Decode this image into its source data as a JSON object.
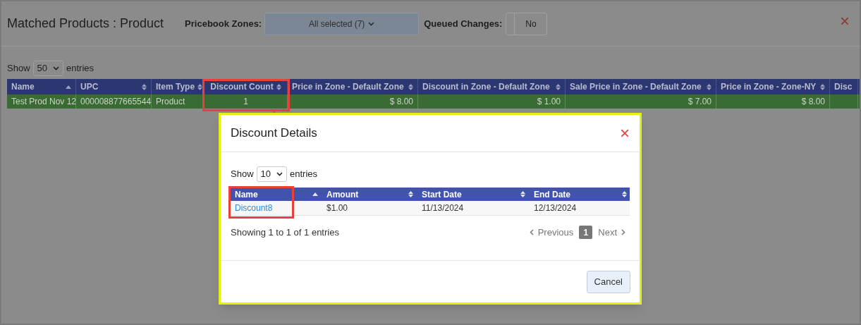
{
  "page": {
    "title": "Matched Products : Product",
    "zones_label": "Pricebook Zones:",
    "zones_value": "All selected (7)",
    "queued_label": "Queued Changes:",
    "queued_value": "No",
    "close": "×"
  },
  "length": {
    "show": "Show",
    "value": "50",
    "entries": "entries"
  },
  "table": {
    "columns": [
      {
        "label": "Name",
        "kind": "sorted"
      },
      {
        "label": "UPC",
        "kind": "text"
      },
      {
        "label": "Item Type",
        "kind": "text"
      },
      {
        "label": "Discount Count",
        "kind": "count"
      },
      {
        "label": "Price in Zone - Default Zone",
        "kind": "money"
      },
      {
        "label": "Discount in Zone - Default Zone",
        "kind": "money"
      },
      {
        "label": "Sale Price in Zone - Default Zone",
        "kind": "money"
      },
      {
        "label": "Price in Zone - Zone-NY",
        "kind": "money"
      },
      {
        "label": "Disc",
        "kind": "cut"
      }
    ],
    "rows": [
      {
        "selected": true,
        "cells": [
          "Test Prod Nov 12",
          "000008877665544",
          "Product",
          "1",
          "$ 8.00",
          "$ 1.00",
          "$ 7.00",
          "$ 8.00",
          ""
        ]
      }
    ]
  },
  "dialog": {
    "title": "Discount Details",
    "close": "×",
    "show": "Show",
    "length": "10",
    "entries": "entries",
    "columns": [
      {
        "label": "Name",
        "kind": "sorted"
      },
      {
        "label": "Amount",
        "kind": "text"
      },
      {
        "label": "Start Date",
        "kind": "text"
      },
      {
        "label": "End Date",
        "kind": "text"
      }
    ],
    "rows": [
      {
        "cells": [
          {
            "text": "Discount8",
            "kind": "link"
          },
          {
            "text": "$1.00",
            "kind": "text"
          },
          {
            "text": "11/13/2024",
            "kind": "text"
          },
          {
            "text": "12/13/2024",
            "kind": "text"
          }
        ]
      }
    ],
    "info": "Showing 1 to 1 of 1 entries",
    "pager": {
      "previous": "Previous",
      "pages": [
        {
          "label": "1",
          "selected": true
        }
      ],
      "next": "Next"
    },
    "cancel": "Cancel"
  }
}
